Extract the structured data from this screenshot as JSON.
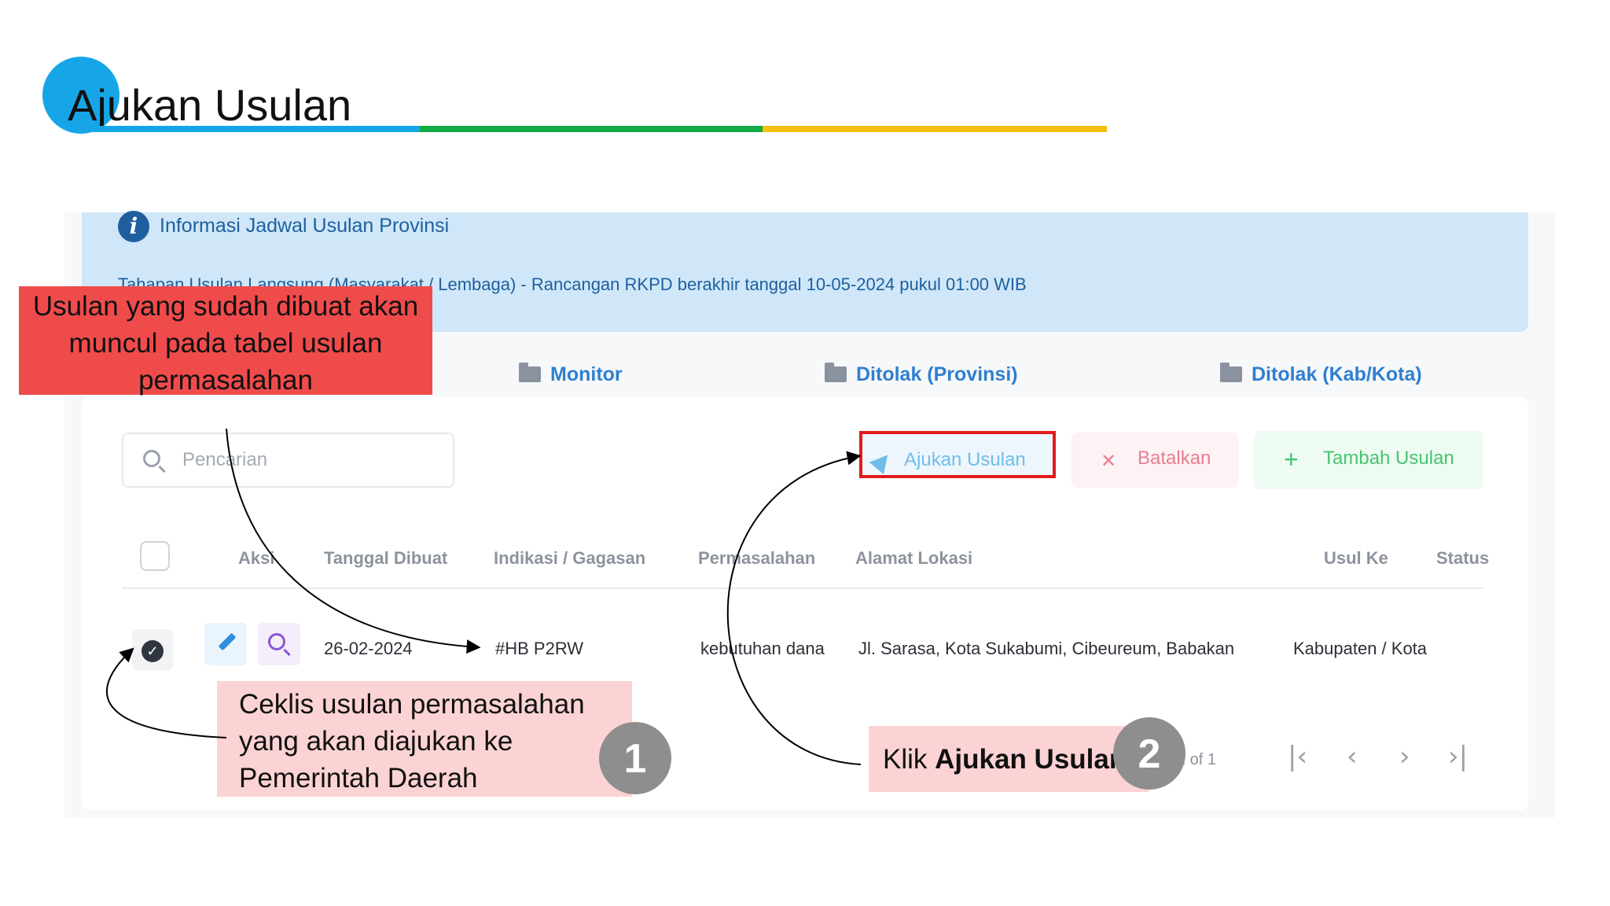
{
  "slide": {
    "title": "Ajukan Usulan"
  },
  "info": {
    "title": "Informasi Jadwal Usulan Provinsi",
    "detail": "Tahapan Usulan Langsung (Masyarakat / Lembaga) - Rancangan RKPD berakhir tanggal 10-05-2024 pukul 01:00 WIB"
  },
  "tabs": [
    {
      "label": "Monitor"
    },
    {
      "label": "Ditolak (Provinsi)"
    },
    {
      "label": "Ditolak (Kab/Kota)"
    }
  ],
  "search": {
    "placeholder": "Pencarian"
  },
  "toolbar": {
    "ajukan_label": "Ajukan Usulan",
    "batal_label": "Batalkan",
    "tambah_label": "Tambah Usulan"
  },
  "table": {
    "headers": [
      "Aksi",
      "Tanggal Dibuat",
      "Indikasi / Gagasan",
      "Permasalahan",
      "Alamat Lokasi",
      "Usul Ke",
      "Status"
    ],
    "rows": [
      {
        "tanggal": "26-02-2024",
        "indikasi": "#HB P2RW",
        "permasalahan": "kebutuhan dana",
        "alamat": "Jl. Sarasa, Kota Sukabumi, Cibeureum, Babakan",
        "usul_ke": "Kabupaten / Kota"
      }
    ]
  },
  "pagination": {
    "text": "1 of 1"
  },
  "annotations": {
    "red_note": "Usulan yang sudah dibuat akan muncul pada tabel usulan permasalahan",
    "step1_note": "Ceklis usulan permasalahan yang akan diajukan ke Pemerintah Daerah",
    "step1_number": "1",
    "step2_prefix": "Klik",
    "step2_bold": "Ajukan Usulan",
    "step2_number": "2"
  },
  "colors": {
    "accent_blue": "#16a6e8",
    "accent_green": "#12ab45",
    "accent_yellow": "#f3c00e",
    "highlight_red": "#e01b1b"
  }
}
